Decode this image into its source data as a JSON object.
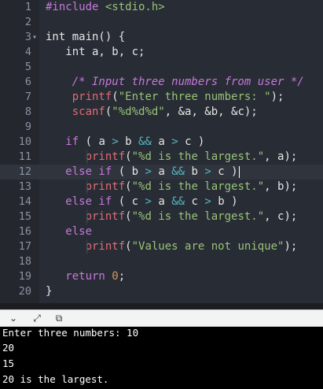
{
  "editor": {
    "lines": [
      {
        "n": "1",
        "tokens": [
          [
            "pp",
            "#include "
          ],
          [
            "inc",
            "<stdio.h>"
          ]
        ]
      },
      {
        "n": "2",
        "tokens": []
      },
      {
        "n": "3",
        "fold": "▾",
        "tokens": [
          [
            "",
            "int main() {"
          ]
        ]
      },
      {
        "n": "4",
        "tokens": [
          [
            "",
            "   int a, b, c;"
          ]
        ]
      },
      {
        "n": "5",
        "tokens": []
      },
      {
        "n": "6",
        "tokens": [
          [
            "cm",
            "    /* Input three numbers from user */"
          ]
        ]
      },
      {
        "n": "7",
        "tokens": [
          [
            "fn",
            "    printf"
          ],
          [
            "",
            "("
          ],
          [
            "str",
            "\"Enter three numbers: \""
          ],
          [
            "",
            ");"
          ]
        ]
      },
      {
        "n": "8",
        "tokens": [
          [
            "fn",
            "    scanf"
          ],
          [
            "",
            "("
          ],
          [
            "str",
            "\"%d%d%d\""
          ],
          [
            "",
            ", &a, &b, &c);"
          ]
        ]
      },
      {
        "n": "9",
        "tokens": []
      },
      {
        "n": "10",
        "tokens": [
          [
            "kw",
            "   if"
          ],
          [
            "",
            " ( a "
          ],
          [
            "op",
            ">"
          ],
          [
            "",
            " b "
          ],
          [
            "op",
            "&&"
          ],
          [
            "",
            " a "
          ],
          [
            "op",
            ">"
          ],
          [
            "",
            " c )"
          ]
        ]
      },
      {
        "n": "11",
        "tokens": [
          [
            "fn",
            "      printf"
          ],
          [
            "",
            "("
          ],
          [
            "str",
            "\"%d is the largest.\""
          ],
          [
            "",
            ", a);"
          ]
        ]
      },
      {
        "n": "12",
        "active": true,
        "tokens": [
          [
            "kw",
            "   else if"
          ],
          [
            "",
            " ( b "
          ],
          [
            "op",
            ">"
          ],
          [
            "",
            " a "
          ],
          [
            "op",
            "&&"
          ],
          [
            "",
            " b "
          ],
          [
            "op",
            ">"
          ],
          [
            "",
            " c )"
          ]
        ]
      },
      {
        "n": "13",
        "tokens": [
          [
            "fn",
            "      printf"
          ],
          [
            "",
            "("
          ],
          [
            "str",
            "\"%d is the largest.\""
          ],
          [
            "",
            ", b);"
          ]
        ]
      },
      {
        "n": "14",
        "tokens": [
          [
            "kw",
            "   else if"
          ],
          [
            "",
            " ( c "
          ],
          [
            "op",
            ">"
          ],
          [
            "",
            " a "
          ],
          [
            "op",
            "&&"
          ],
          [
            "",
            " c "
          ],
          [
            "op",
            ">"
          ],
          [
            "",
            " b )"
          ]
        ]
      },
      {
        "n": "15",
        "tokens": [
          [
            "fn",
            "      printf"
          ],
          [
            "",
            "("
          ],
          [
            "str",
            "\"%d is the largest.\""
          ],
          [
            "",
            ", c);"
          ]
        ]
      },
      {
        "n": "16",
        "tokens": [
          [
            "kw",
            "   else"
          ]
        ]
      },
      {
        "n": "17",
        "tokens": [
          [
            "fn",
            "      printf"
          ],
          [
            "",
            "("
          ],
          [
            "str",
            "\"Values are not unique\""
          ],
          [
            "",
            ");"
          ]
        ]
      },
      {
        "n": "18",
        "tokens": []
      },
      {
        "n": "19",
        "tokens": [
          [
            "kw",
            "   return"
          ],
          [
            "",
            " "
          ],
          [
            "num",
            "0"
          ],
          [
            "",
            ";"
          ]
        ]
      },
      {
        "n": "20",
        "tokens": [
          [
            "",
            "}"
          ]
        ]
      }
    ]
  },
  "toolbar": {
    "icons": [
      {
        "name": "collapse-chevron-icon",
        "glyph": "⌄"
      },
      {
        "name": "expand-arrows-icon",
        "glyph": "⤢"
      },
      {
        "name": "copy-output-icon",
        "glyph": "⧉"
      }
    ]
  },
  "terminal": {
    "lines": [
      "Enter three numbers: 10",
      "20",
      "15",
      "20 is the largest."
    ]
  }
}
